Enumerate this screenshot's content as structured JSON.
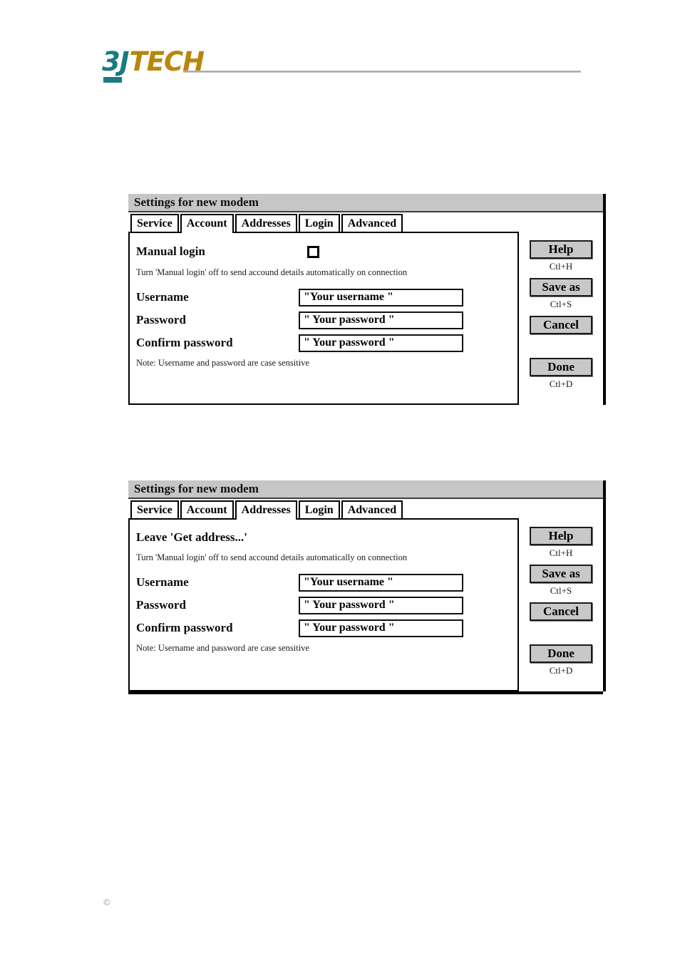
{
  "header": {
    "logo_part1": "3J",
    "logo_part2": "TECH",
    "logo_color_teal": "#1b7b81",
    "logo_color_gold": "#b8860b"
  },
  "footer": {
    "copyright_mark": "©"
  },
  "dialogs": [
    {
      "title": "Settings for new modem",
      "tabs": [
        {
          "label": "Service",
          "active": false
        },
        {
          "label": "Account",
          "active": true
        },
        {
          "label": "Addresses",
          "active": false
        },
        {
          "label": "Login",
          "active": false
        },
        {
          "label": "Advanced",
          "active": false
        }
      ],
      "heading": "Manual login",
      "checkbox_checked": false,
      "hint": "Turn 'Manual login' off to send accound details automatically on connection",
      "fields": [
        {
          "label": "Username",
          "value": "\"Your username \""
        },
        {
          "label": "Password",
          "value": "\" Your password \""
        },
        {
          "label": "Confirm password",
          "value": "\" Your password \""
        }
      ],
      "note": "Note: Username and password are case sensitive",
      "buttons": [
        {
          "label": "Help",
          "shortcut": "Ctl+H"
        },
        {
          "label": "Save as",
          "shortcut": "Ctl+S"
        },
        {
          "label": "Cancel",
          "shortcut": ""
        },
        {
          "label": "Done",
          "shortcut": "Ctl+D"
        }
      ]
    },
    {
      "title": "Settings for new modem",
      "tabs": [
        {
          "label": "Service",
          "active": false
        },
        {
          "label": "Account",
          "active": false
        },
        {
          "label": "Addresses",
          "active": true
        },
        {
          "label": "Login",
          "active": false
        },
        {
          "label": "Advanced",
          "active": false
        }
      ],
      "heading": "Leave 'Get address...'",
      "checkbox_checked": null,
      "hint": "Turn 'Manual login' off to send accound details automatically on connection",
      "fields": [
        {
          "label": "Username",
          "value": "\"Your username \""
        },
        {
          "label": "Password",
          "value": "\" Your password \""
        },
        {
          "label": "Confirm password",
          "value": "\" Your password \""
        }
      ],
      "note": "Note: Username and password are case sensitive",
      "buttons": [
        {
          "label": "Help",
          "shortcut": "Ctl+H"
        },
        {
          "label": "Save as",
          "shortcut": "Ctl+S"
        },
        {
          "label": "Cancel",
          "shortcut": ""
        },
        {
          "label": "Done",
          "shortcut": "Ctl+D"
        }
      ]
    }
  ]
}
